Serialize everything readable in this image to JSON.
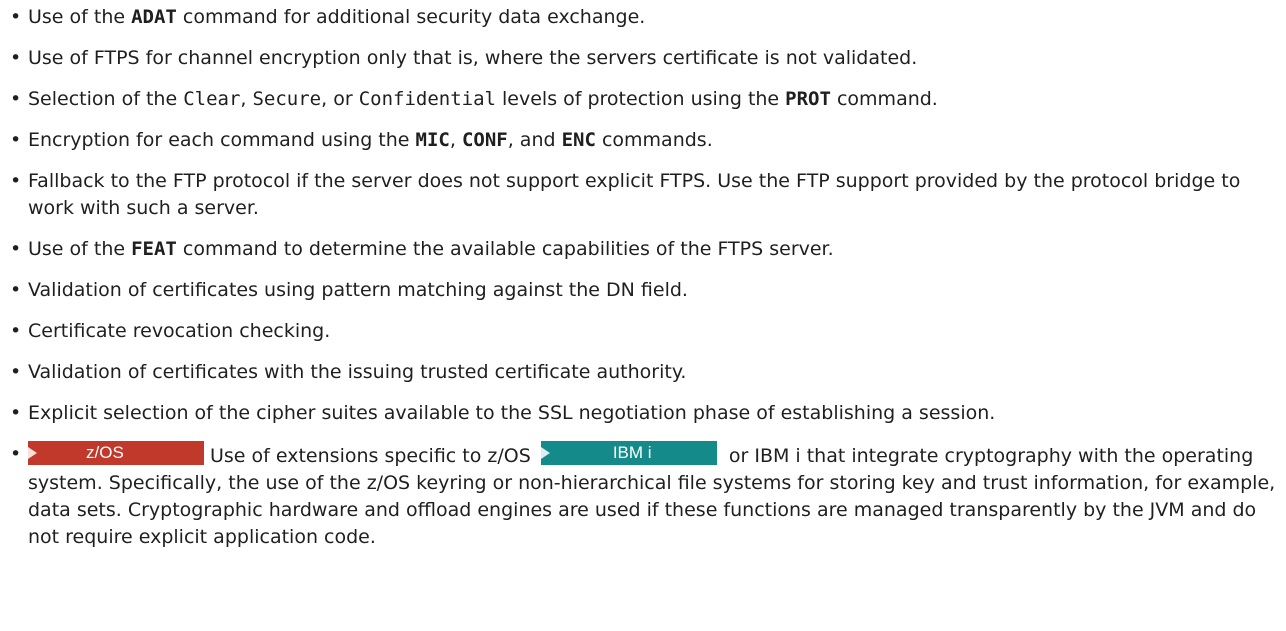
{
  "items": [
    {
      "pre": "Use of the ",
      "bold": "ADAT",
      "post": " command for additional security data exchange."
    },
    {
      "text": "Use of FTPS for channel encryption only that is, where the servers certificate is not validated."
    },
    {
      "pre": "Selection of the ",
      "code1": "Clear",
      "sep1": ", ",
      "code2": "Secure",
      "sep2": ", or ",
      "code3": "Confidential",
      "mid": " levels of protection using the ",
      "bold": "PROT",
      "post": " command."
    },
    {
      "pre": "Encryption for each command using the ",
      "bold1": "MIC",
      "sep1": ", ",
      "bold2": "CONF",
      "sep2": ", and ",
      "bold3": "ENC",
      "post": " commands."
    },
    {
      "text": "Fallback to the FTP protocol if the server does not support explicit FTPS. Use the FTP support provided by the protocol bridge to work with such a server."
    },
    {
      "pre": "Use of the ",
      "bold": "FEAT",
      "post": " command to determine the available capabilities of the FTPS server."
    },
    {
      "text": "Validation of certificates using pattern matching against the DN field."
    },
    {
      "text": "Certificate revocation checking."
    },
    {
      "text": "Validation of certificates with the issuing trusted certificate authority."
    },
    {
      "text": "Explicit selection of the cipher suites available to the SSL negotiation phase of establishing a session."
    },
    {
      "badge1": "z/OS",
      "pre": "Use of extensions specific to z/OS ",
      "badge2": "IBM i",
      "post": " or IBM i that integrate cryptography with the operating system. Specifically, the use of the z/OS keyring or non-hierarchical file systems for storing key and trust information, for example, data sets. Cryptographic hardware and offload engines are used if these functions are managed transparently by the JVM and do not require explicit application code."
    }
  ],
  "colors": {
    "zos_badge": "#c0392b",
    "ibmi_badge": "#148a8a"
  }
}
